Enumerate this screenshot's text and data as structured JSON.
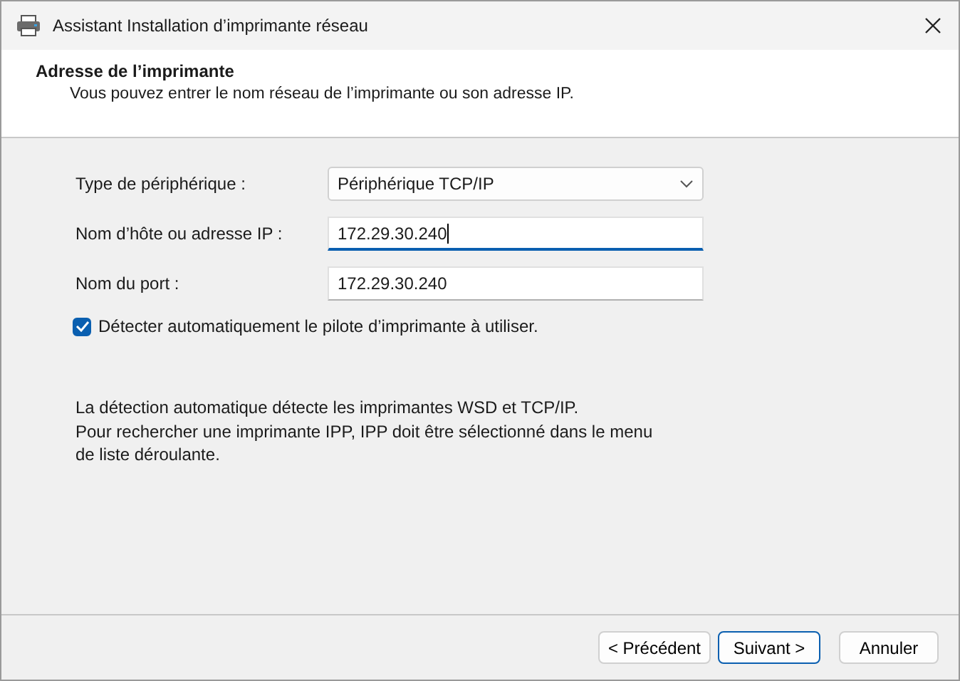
{
  "window": {
    "title": "Assistant Installation d’imprimante réseau"
  },
  "header": {
    "title": "Adresse de l’imprimante",
    "subtitle": "Vous pouvez entrer le nom réseau de l’imprimante ou son adresse IP."
  },
  "fields": [
    {
      "kind": "dropdown",
      "label": "Type de périphérique :",
      "value": "Périphérique TCP/IP",
      "focused": false
    },
    {
      "kind": "input",
      "label": "Nom d’hôte ou adresse IP :",
      "value": "172.29.30.240",
      "focused": true
    },
    {
      "kind": "input",
      "label": "Nom du port :",
      "value": "172.29.30.240",
      "focused": false
    }
  ],
  "auto_detect": {
    "label": "Détecter automatiquement le pilote d’imprimante à utiliser.",
    "checked": true
  },
  "info": "La détection automatique détecte les imprimantes WSD et TCP/IP.\nPour rechercher une imprimante IPP, IPP doit être sélectionné dans le menu\nde liste déroulante.",
  "buttons": [
    {
      "label": "< Précédent",
      "default": false
    },
    {
      "label": "Suivant >",
      "default": true
    },
    {
      "label": "Annuler",
      "default": false
    }
  ]
}
